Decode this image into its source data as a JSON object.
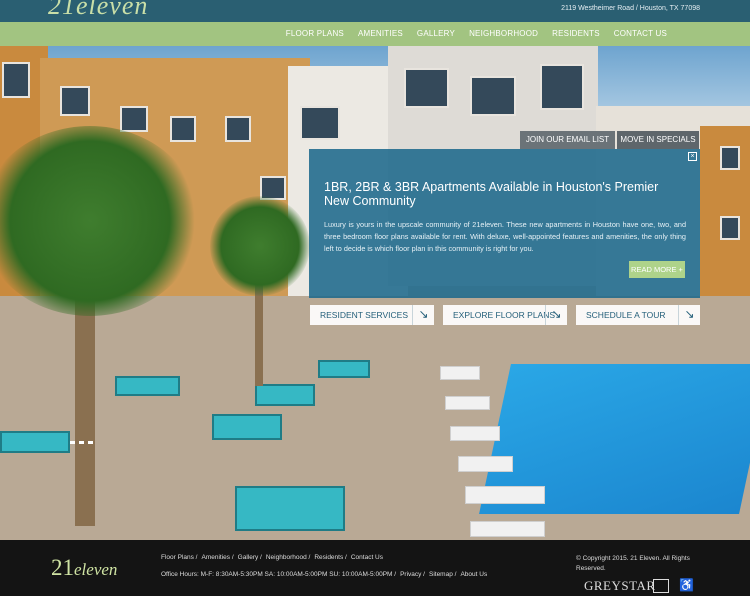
{
  "header": {
    "logo": "21eleven",
    "address": "2119 Westheimer Road / Houston, TX 77098",
    "nav": [
      "FLOOR PLANS",
      "AMENITIES",
      "GALLERY",
      "NEIGHBORHOOD",
      "RESIDENTS",
      "CONTACT US"
    ]
  },
  "tabs": {
    "email": "JOIN OUR EMAIL LIST",
    "specials": "MOVE IN SPECIALS"
  },
  "panel": {
    "close": "×",
    "title": "1BR, 2BR & 3BR Apartments Available in Houston's Premier New Community",
    "body": "Luxury is yours in the upscale community of 21eleven. These new apartments in Houston have one, two, and three bedroom floor plans available for rent. With deluxe, well-appointed features and amenities, the only thing left to decide is which floor plan in this community is right for you.",
    "read_more": "READ MORE +"
  },
  "ctas": [
    {
      "label": "RESIDENT SERVICES",
      "icon": "arrow-down-right-icon"
    },
    {
      "label": "EXPLORE FLOOR PLANS",
      "icon": "arrow-down-right-icon"
    },
    {
      "label": "SCHEDULE A TOUR",
      "icon": "arrow-down-right-icon"
    }
  ],
  "footer": {
    "logo_num": "21",
    "logo_word": "eleven",
    "links_row1": [
      "Floor Plans /",
      "Amenities /",
      "Gallery /",
      "Neighborhood /",
      "Residents /",
      "Contact Us"
    ],
    "links_row2": [
      "Office Hours: M-F: 8:30AM-5:30PM SA: 10:00AM-5:00PM SU: 10:00AM-5:00PM /",
      "Privacy /",
      "Sitemap /",
      "About Us"
    ],
    "copyright": "© Copyright 2015. 21 Eleven. All Rights Reserved.",
    "greystar": "GREYSTAR"
  }
}
